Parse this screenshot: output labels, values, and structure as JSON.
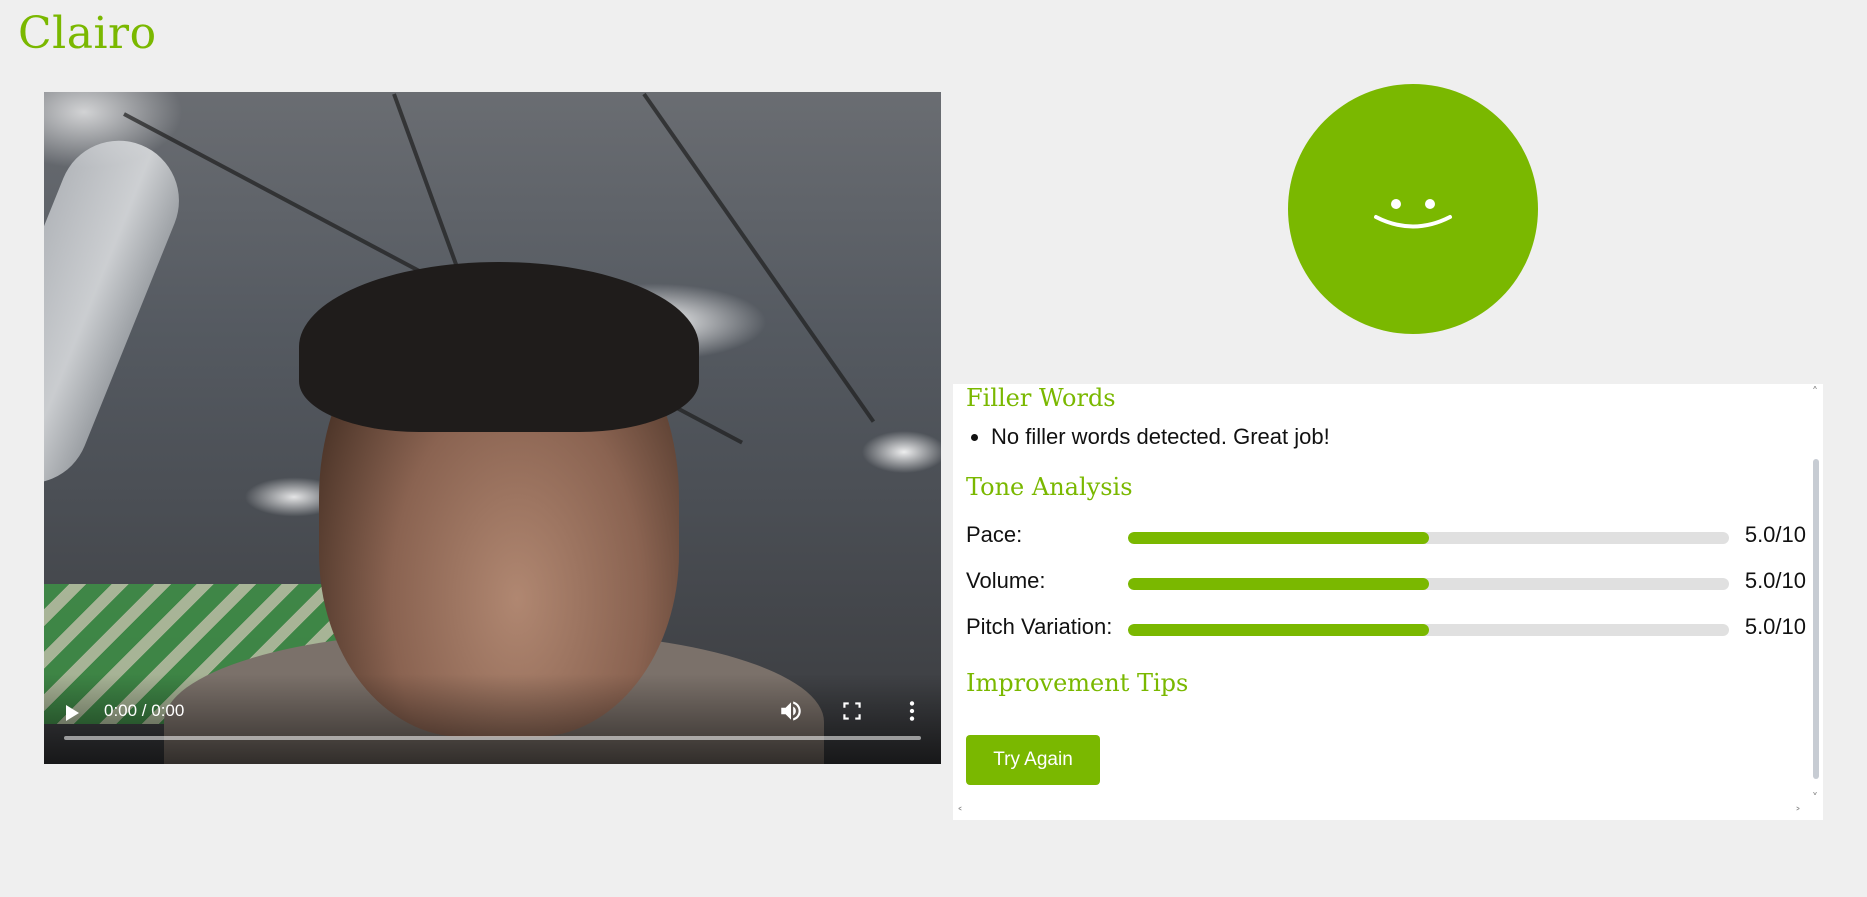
{
  "app": {
    "title": "Clairo"
  },
  "video": {
    "time_display": "0:00 / 0:00",
    "progress": 0
  },
  "smiley": {
    "mood": "happy",
    "color": "#7ab800"
  },
  "feedback": {
    "filler_words": {
      "heading": "Filler Words",
      "items": [
        "No filler words detected. Great job!"
      ]
    },
    "tone_analysis": {
      "heading": "Tone Analysis",
      "metrics": [
        {
          "label": "Pace:",
          "score": 5.0,
          "max": 10,
          "display": "5.0/10"
        },
        {
          "label": "Volume:",
          "score": 5.0,
          "max": 10,
          "display": "5.0/10"
        },
        {
          "label": "Pitch Variation:",
          "score": 5.0,
          "max": 10,
          "display": "5.0/10"
        }
      ]
    },
    "improvement_tips": {
      "heading": "Improvement Tips"
    },
    "try_again_label": "Try Again"
  },
  "colors": {
    "accent": "#7ab800",
    "background": "#efefef",
    "track": "#e0e0e0"
  }
}
